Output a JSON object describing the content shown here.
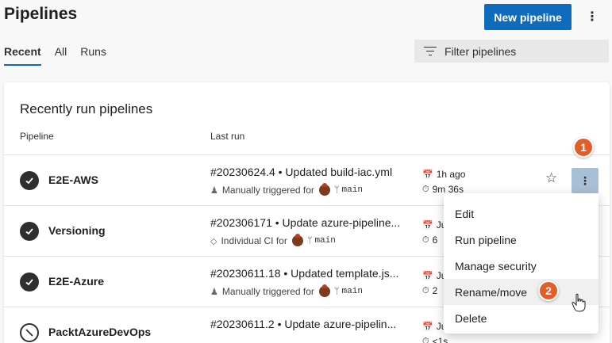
{
  "header": {
    "title": "Pipelines",
    "new_button": "New pipeline",
    "more_label": "⋮"
  },
  "tabs": [
    {
      "label": "Recent",
      "active": true
    },
    {
      "label": "All",
      "active": false
    },
    {
      "label": "Runs",
      "active": false
    }
  ],
  "filter": {
    "placeholder": "Filter pipelines"
  },
  "section": {
    "title": "Recently run pipelines",
    "col_pipeline": "Pipeline",
    "col_last_run": "Last run"
  },
  "rows": [
    {
      "name": "E2E-AWS",
      "status": "succeeded",
      "run_title": "#20230624.4 • Updated build-iac.yml",
      "trigger_icon": "person-icon",
      "trigger": "Manually triggered for",
      "branch": "main",
      "time_ago": "1h ago",
      "duration": "9m 36s"
    },
    {
      "name": "Versioning",
      "status": "succeeded",
      "run_title": "#202306171 • Update azure-pipeline...",
      "trigger_icon": "tag-icon",
      "trigger": "Individual CI for",
      "branch": "main",
      "time_ago": "Ju",
      "duration": "6"
    },
    {
      "name": "E2E-Azure",
      "status": "succeeded",
      "run_title": "#20230611.18 • Updated template.js...",
      "trigger_icon": "person-icon",
      "trigger": "Manually triggered for",
      "branch": "main",
      "time_ago": "Ju",
      "duration": "2"
    },
    {
      "name": "PacktAzureDevOps",
      "status": "not-started",
      "run_title": "#20230611.2 • Update azure-pipelin...",
      "trigger_icon": "",
      "trigger": "",
      "branch": "",
      "time_ago": "Ju",
      "duration": "<1s"
    }
  ],
  "menu": {
    "items": [
      "Edit",
      "Run pipeline",
      "Manage security",
      "Rename/move",
      "Delete"
    ],
    "hovered": "Rename/move"
  },
  "badges": {
    "one": "1",
    "two": "2"
  },
  "colors": {
    "primary": "#0f6cbd",
    "badge": "#e35d2a",
    "more_active": "#a9bfd6"
  },
  "icons": {
    "check": "✓",
    "star": "☆",
    "calendar": "📅",
    "timer": "⏱",
    "branch": "ᛘ"
  }
}
